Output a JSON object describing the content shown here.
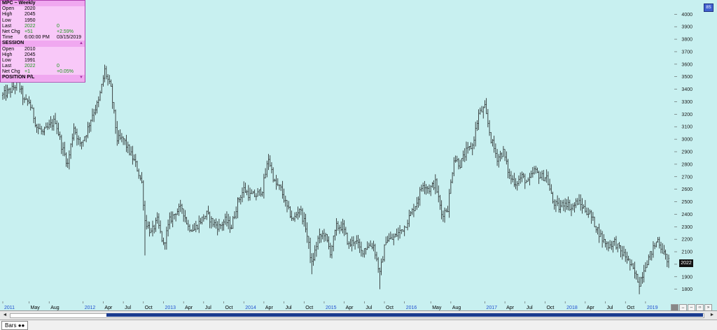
{
  "info_panel": {
    "title": "MPC ~ Weekly",
    "rows": [
      {
        "label": "Open",
        "v1": "2020",
        "v2": "",
        "green": false
      },
      {
        "label": "High",
        "v1": "2045",
        "v2": "",
        "green": false
      },
      {
        "label": "Low",
        "v1": "1950",
        "v2": "",
        "green": false
      },
      {
        "label": "Last",
        "v1": "2022",
        "v2": "0",
        "green": true
      },
      {
        "label": "Net Chg",
        "v1": "+51",
        "v2": "+2.59%",
        "green": true
      },
      {
        "label": "Time",
        "v1": "6:00:00 PM",
        "v2": "03/15/2019",
        "green": false
      }
    ],
    "session_title": "SESSION",
    "session_rows": [
      {
        "label": "Open",
        "v1": "2010",
        "v2": "",
        "green": false
      },
      {
        "label": "High",
        "v1": "2045",
        "v2": "",
        "green": false
      },
      {
        "label": "Low",
        "v1": "1991",
        "v2": "",
        "green": false
      },
      {
        "label": "Last",
        "v1": "2022",
        "v2": "0",
        "green": true
      },
      {
        "label": "Net Chg",
        "v1": "+1",
        "v2": "+0.05%",
        "green": true
      }
    ],
    "position_title": "POSITION P/L"
  },
  "last_price_tag": "2022",
  "legend_badge": "8S",
  "status_bar": {
    "tab_label": "Bars"
  },
  "colors": {
    "background": "#c8f0f0",
    "bars": "#1a1a1a",
    "year_label": "#2050d0",
    "month_label": "#000000"
  },
  "chart_data": {
    "type": "bar",
    "subtype": "ohlc",
    "x_axis_labels": [
      {
        "label": "2011",
        "year": true,
        "week": 0
      },
      {
        "label": "May",
        "year": false,
        "week": 17
      },
      {
        "label": "Aug",
        "year": false,
        "week": 30
      },
      {
        "label": "2012",
        "year": true,
        "week": 52
      },
      {
        "label": "Apr",
        "year": false,
        "week": 65
      },
      {
        "label": "Jul",
        "year": false,
        "week": 78
      },
      {
        "label": "Oct",
        "year": false,
        "week": 91
      },
      {
        "label": "2013",
        "year": true,
        "week": 104
      },
      {
        "label": "Apr",
        "year": false,
        "week": 117
      },
      {
        "label": "Jul",
        "year": false,
        "week": 130
      },
      {
        "label": "Oct",
        "year": false,
        "week": 143
      },
      {
        "label": "2014",
        "year": true,
        "week": 156
      },
      {
        "label": "Apr",
        "year": false,
        "week": 169
      },
      {
        "label": "Jul",
        "year": false,
        "week": 182
      },
      {
        "label": "Oct",
        "year": false,
        "week": 195
      },
      {
        "label": "2015",
        "year": true,
        "week": 208
      },
      {
        "label": "Apr",
        "year": false,
        "week": 221
      },
      {
        "label": "Jul",
        "year": false,
        "week": 234
      },
      {
        "label": "Oct",
        "year": false,
        "week": 247
      },
      {
        "label": "2016",
        "year": true,
        "week": 260
      },
      {
        "label": "May",
        "year": false,
        "week": 277
      },
      {
        "label": "Aug",
        "year": false,
        "week": 290
      },
      {
        "label": "2017",
        "year": true,
        "week": 312
      },
      {
        "label": "Apr",
        "year": false,
        "week": 325
      },
      {
        "label": "Jul",
        "year": false,
        "week": 338
      },
      {
        "label": "Oct",
        "year": false,
        "week": 351
      },
      {
        "label": "2018",
        "year": true,
        "week": 364
      },
      {
        "label": "Apr",
        "year": false,
        "week": 377
      },
      {
        "label": "Jul",
        "year": false,
        "week": 390
      },
      {
        "label": "Oct",
        "year": false,
        "week": 403
      },
      {
        "label": "2019",
        "year": true,
        "week": 416
      }
    ],
    "y_ticks": [
      1800,
      1900,
      2000,
      2100,
      2200,
      2300,
      2400,
      2500,
      2600,
      2700,
      2800,
      2900,
      3000,
      3100,
      3200,
      3300,
      3400,
      3500,
      3600,
      3700,
      3800,
      3900,
      4000
    ],
    "ylim": [
      1720,
      4080
    ],
    "xlim": [
      0,
      431
    ],
    "anchors": [
      [
        0,
        3350
      ],
      [
        6,
        3400
      ],
      [
        10,
        3450
      ],
      [
        14,
        3300
      ],
      [
        17,
        3300
      ],
      [
        22,
        3100
      ],
      [
        26,
        3050
      ],
      [
        30,
        3100
      ],
      [
        34,
        3150
      ],
      [
        38,
        2950
      ],
      [
        42,
        2800
      ],
      [
        46,
        3100
      ],
      [
        50,
        2950
      ],
      [
        54,
        3050
      ],
      [
        58,
        3200
      ],
      [
        62,
        3300
      ],
      [
        66,
        3550
      ],
      [
        70,
        3400
      ],
      [
        74,
        3000
      ],
      [
        78,
        3000
      ],
      [
        82,
        2900
      ],
      [
        86,
        2800
      ],
      [
        90,
        2650
      ],
      [
        92,
        2350
      ],
      [
        96,
        2250
      ],
      [
        100,
        2350
      ],
      [
        104,
        2150
      ],
      [
        108,
        2350
      ],
      [
        112,
        2420
      ],
      [
        116,
        2450
      ],
      [
        120,
        2300
      ],
      [
        124,
        2280
      ],
      [
        128,
        2350
      ],
      [
        132,
        2400
      ],
      [
        136,
        2330
      ],
      [
        140,
        2300
      ],
      [
        144,
        2350
      ],
      [
        148,
        2300
      ],
      [
        152,
        2500
      ],
      [
        156,
        2600
      ],
      [
        160,
        2550
      ],
      [
        164,
        2550
      ],
      [
        168,
        2600
      ],
      [
        172,
        2850
      ],
      [
        176,
        2650
      ],
      [
        180,
        2600
      ],
      [
        184,
        2450
      ],
      [
        188,
        2350
      ],
      [
        192,
        2450
      ],
      [
        196,
        2300
      ],
      [
        200,
        2000
      ],
      [
        204,
        2200
      ],
      [
        208,
        2250
      ],
      [
        212,
        2100
      ],
      [
        216,
        2300
      ],
      [
        220,
        2300
      ],
      [
        224,
        2150
      ],
      [
        228,
        2200
      ],
      [
        232,
        2100
      ],
      [
        236,
        2150
      ],
      [
        240,
        2150
      ],
      [
        244,
        1920
      ],
      [
        248,
        2200
      ],
      [
        252,
        2200
      ],
      [
        256,
        2250
      ],
      [
        260,
        2300
      ],
      [
        264,
        2400
      ],
      [
        268,
        2500
      ],
      [
        272,
        2650
      ],
      [
        276,
        2600
      ],
      [
        280,
        2650
      ],
      [
        284,
        2400
      ],
      [
        288,
        2450
      ],
      [
        292,
        2850
      ],
      [
        296,
        2800
      ],
      [
        300,
        2900
      ],
      [
        304,
        2950
      ],
      [
        308,
        3200
      ],
      [
        312,
        3250
      ],
      [
        316,
        3000
      ],
      [
        320,
        2850
      ],
      [
        324,
        2900
      ],
      [
        328,
        2700
      ],
      [
        332,
        2650
      ],
      [
        336,
        2700
      ],
      [
        340,
        2650
      ],
      [
        344,
        2750
      ],
      [
        348,
        2700
      ],
      [
        352,
        2700
      ],
      [
        356,
        2500
      ],
      [
        360,
        2450
      ],
      [
        364,
        2500
      ],
      [
        368,
        2450
      ],
      [
        372,
        2500
      ],
      [
        376,
        2450
      ],
      [
        380,
        2400
      ],
      [
        384,
        2300
      ],
      [
        388,
        2200
      ],
      [
        392,
        2150
      ],
      [
        396,
        2180
      ],
      [
        400,
        2100
      ],
      [
        404,
        2050
      ],
      [
        408,
        1950
      ],
      [
        412,
        1850
      ],
      [
        416,
        2000
      ],
      [
        420,
        2100
      ],
      [
        424,
        2200
      ],
      [
        428,
        2080
      ],
      [
        431,
        2022
      ]
    ],
    "lows": [
      [
        92,
        2070
      ],
      [
        244,
        1800
      ],
      [
        412,
        1760
      ],
      [
        200,
        1920
      ]
    ]
  }
}
